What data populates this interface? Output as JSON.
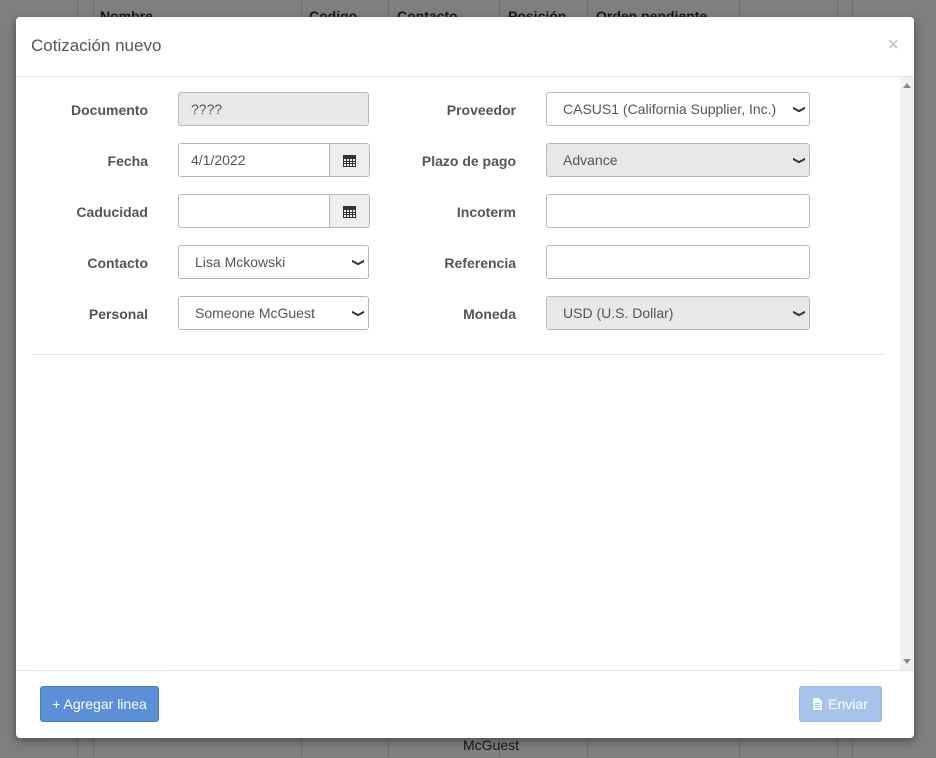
{
  "background": {
    "headers": [
      "Nombre",
      "Codigo",
      "Contacto",
      "Posición",
      "Orden pendiente"
    ],
    "visible_cell": "McGuest"
  },
  "modal": {
    "title": "Cotización nuevo",
    "close_label": "×",
    "left_fields": [
      {
        "label": "Documento",
        "value": "????"
      },
      {
        "label": "Fecha",
        "value": "4/1/2022"
      },
      {
        "label": "Caducidad",
        "value": ""
      },
      {
        "label": "Contacto",
        "value": "Lisa Mckowski"
      },
      {
        "label": "Personal",
        "value": "Someone McGuest"
      }
    ],
    "right_fields": [
      {
        "label": "Proveedor",
        "value": "CASUS1 (California Supplier, Inc.)"
      },
      {
        "label": "Plazo de pago",
        "value": "Advance"
      },
      {
        "label": "Incoterm",
        "value": ""
      },
      {
        "label": "Referencia",
        "value": ""
      },
      {
        "label": "Moneda",
        "value": "USD (U.S. Dollar)"
      }
    ],
    "footer": {
      "add_line_label": "+ Agregar linea",
      "send_label": "Enviar"
    }
  },
  "colors": {
    "primary": "#5b8fd6",
    "primary_disabled": "#a8c3ea",
    "disabled_field": "#e8e8e8"
  },
  "icons": {
    "calendar": "calendar-icon",
    "send": "file-icon",
    "close": "close-icon"
  }
}
